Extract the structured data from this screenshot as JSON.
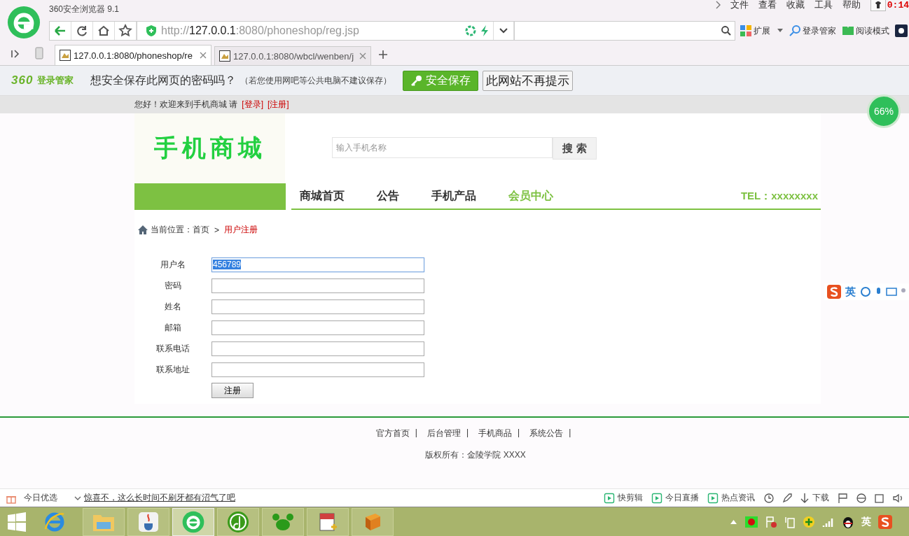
{
  "browser": {
    "title": "360安全浏览器 9.1",
    "menu": [
      "文件",
      "查看",
      "收藏",
      "工具",
      "帮助"
    ],
    "clock": "0:14",
    "address": {
      "scheme": "http://",
      "host": "127.0.0.1",
      "path": ":8080/phoneshop/reg.jsp"
    },
    "tools": [
      "扩展",
      "登录管家",
      "阅读模式"
    ],
    "tabs": [
      {
        "label": "127.0.0.1:8080/phoneshop/re",
        "selected": true
      },
      {
        "label": "127.0.0.1:8080/wbcl/wenben/j",
        "selected": false
      }
    ]
  },
  "password_bar": {
    "brand": "360",
    "brand_name": "登录管家",
    "question": "想安全保存此网页的密码吗？",
    "note": "（若您使用网吧等公共电脑不建议保存）",
    "save": "安全保存",
    "never": "此网站不再提示"
  },
  "speed_widget": "66%",
  "site": {
    "greeting": "您好！欢迎来到手机商城 请",
    "login": "[登录]",
    "register": "[注册]",
    "logo": "手机商城",
    "search": {
      "placeholder": "输入手机名称",
      "button": "搜 索"
    },
    "nav": [
      {
        "label": "商城首页",
        "selected": false
      },
      {
        "label": "公告",
        "selected": false
      },
      {
        "label": "手机产品",
        "selected": false
      },
      {
        "label": "会员中心",
        "selected": true
      }
    ],
    "tel": "TEL：xxxxxxxx",
    "breadcrumb": {
      "prefix": "当前位置：首页",
      "separator": ">",
      "current": "用户注册"
    },
    "form": [
      {
        "label": "用户名",
        "value": "456789",
        "highlighted": true
      },
      {
        "label": "密码",
        "highlighted": false
      },
      {
        "label": "姓名",
        "highlighted": false
      },
      {
        "label": "邮箱",
        "highlighted": false
      },
      {
        "label": "联系电话",
        "highlighted": false
      },
      {
        "label": "联系地址",
        "highlighted": false
      }
    ],
    "submit": "注册",
    "footer_links": [
      "官方首页",
      "后台管理",
      "手机商品",
      "系统公告"
    ],
    "footer_separator": "|",
    "copyright": "版权所有：金陵学院 XXXX"
  },
  "ime_bar": {
    "mode": "英"
  },
  "status_bar": {
    "left": "今日优选",
    "news": "惊喜不，这么长时间不刷牙都有沼气了吧",
    "right": [
      "快剪辑",
      "今日直播",
      "热点资讯"
    ],
    "download": "下载"
  },
  "taskbar": {
    "ime": "英"
  }
}
